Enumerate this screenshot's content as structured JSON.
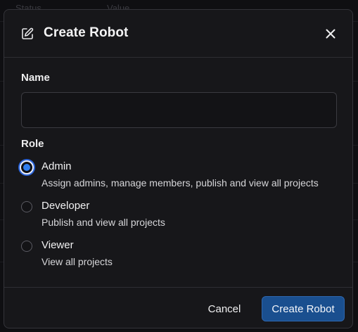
{
  "background": {
    "columns": [
      "Status",
      "Value"
    ]
  },
  "dialog": {
    "title": "Create Robot",
    "title_icon": "edit-icon",
    "close_icon": "close-icon"
  },
  "form": {
    "name_label": "Name",
    "name_value": "",
    "name_placeholder": "",
    "role_label": "Role",
    "selected_role": "Admin",
    "roles": [
      {
        "title": "Admin",
        "description": "Assign admins, manage members, publish and view all projects",
        "checked": true
      },
      {
        "title": "Developer",
        "description": "Publish and view all projects",
        "checked": false
      },
      {
        "title": "Viewer",
        "description": "View all projects",
        "checked": false
      }
    ]
  },
  "footer": {
    "cancel_label": "Cancel",
    "create_label": "Create Robot"
  },
  "colors": {
    "accent": "#2f7ef0",
    "primary_button": "#1a4f8f",
    "dialog_bg": "#17171a"
  }
}
